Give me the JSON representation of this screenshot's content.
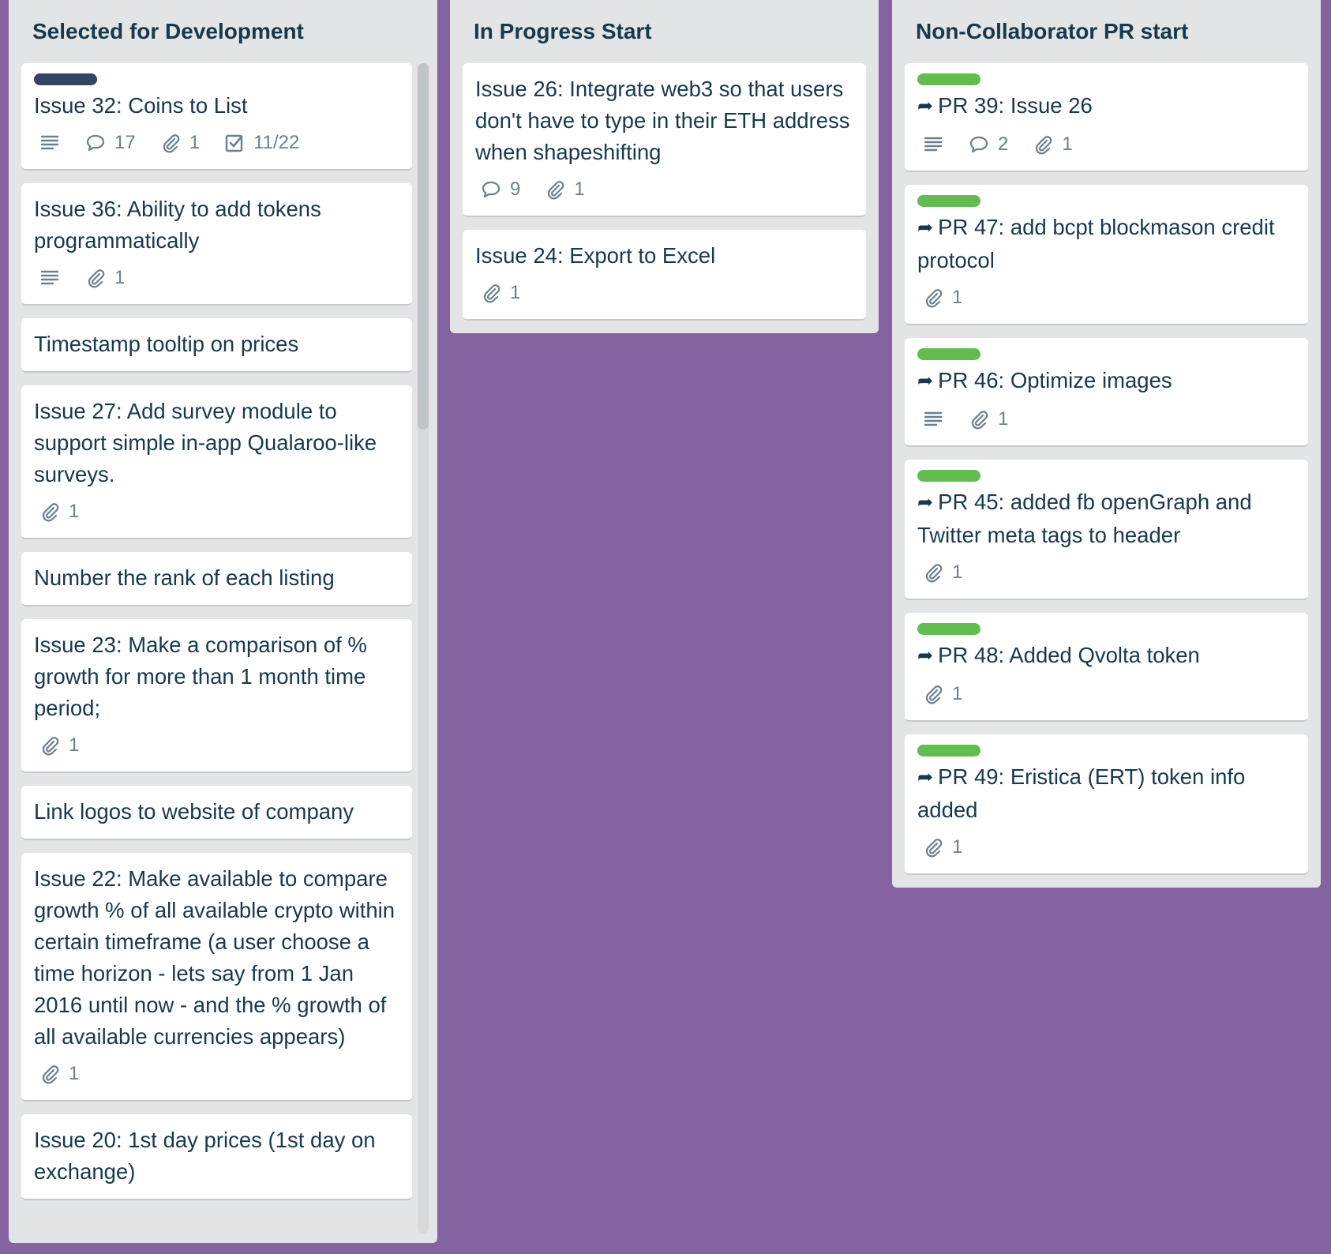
{
  "colors": {
    "board_bg": "#8563A0",
    "list_bg": "#E2E4E6",
    "label_dark": "#344563",
    "label_green": "#61BD4F"
  },
  "lists": [
    {
      "title": "Selected for Development",
      "cards": [
        {
          "title": "Issue 32: Coins to List",
          "label": "dark",
          "description": true,
          "comments": "17",
          "attachments": "1",
          "checklist": "11/22"
        },
        {
          "title": "Issue 36: Ability to add tokens programmatically",
          "description": true,
          "attachments": "1"
        },
        {
          "title": "Timestamp tooltip on prices"
        },
        {
          "title": "Issue 27: Add survey module to support simple in-app Qualaroo-like surveys.",
          "attachments": "1"
        },
        {
          "title": "Number the rank of each listing"
        },
        {
          "title": "Issue 23: Make a comparison of % growth for more than 1 month time period;",
          "attachments": "1"
        },
        {
          "title": "Link logos to website of company"
        },
        {
          "title": "Issue 22: Make available to compare growth % of all available crypto within certain timeframe (a user choose a time horizon - lets say from 1 Jan 2016 until now - and the % growth of all available currencies appears)",
          "attachments": "1"
        },
        {
          "title": "Issue 20: 1st day prices (1st day on exchange)"
        }
      ]
    },
    {
      "title": "In Progress Start",
      "cards": [
        {
          "title": "Issue 26: Integrate web3 so that users don't have to type in their ETH address when shapeshifting",
          "comments": "9",
          "attachments": "1"
        },
        {
          "title": "Issue 24: Export to Excel",
          "attachments": "1"
        }
      ]
    },
    {
      "title": "Non-Collaborator PR start",
      "cards": [
        {
          "title": "PR 39: Issue 26",
          "label": "green",
          "pr": true,
          "description": true,
          "comments": "2",
          "attachments": "1"
        },
        {
          "title": "PR 47: add bcpt blockmason credit protocol",
          "label": "green",
          "pr": true,
          "attachments": "1"
        },
        {
          "title": "PR 46: Optimize images",
          "label": "green",
          "pr": true,
          "description": true,
          "attachments": "1"
        },
        {
          "title": "PR 45: added fb openGraph and Twitter meta tags to header",
          "label": "green",
          "pr": true,
          "attachments": "1"
        },
        {
          "title": "PR 48: Added Qvolta token",
          "label": "green",
          "pr": true,
          "attachments": "1"
        },
        {
          "title": "PR 49: Eristica (ERT) token info added",
          "label": "green",
          "pr": true,
          "attachments": "1"
        }
      ]
    }
  ]
}
